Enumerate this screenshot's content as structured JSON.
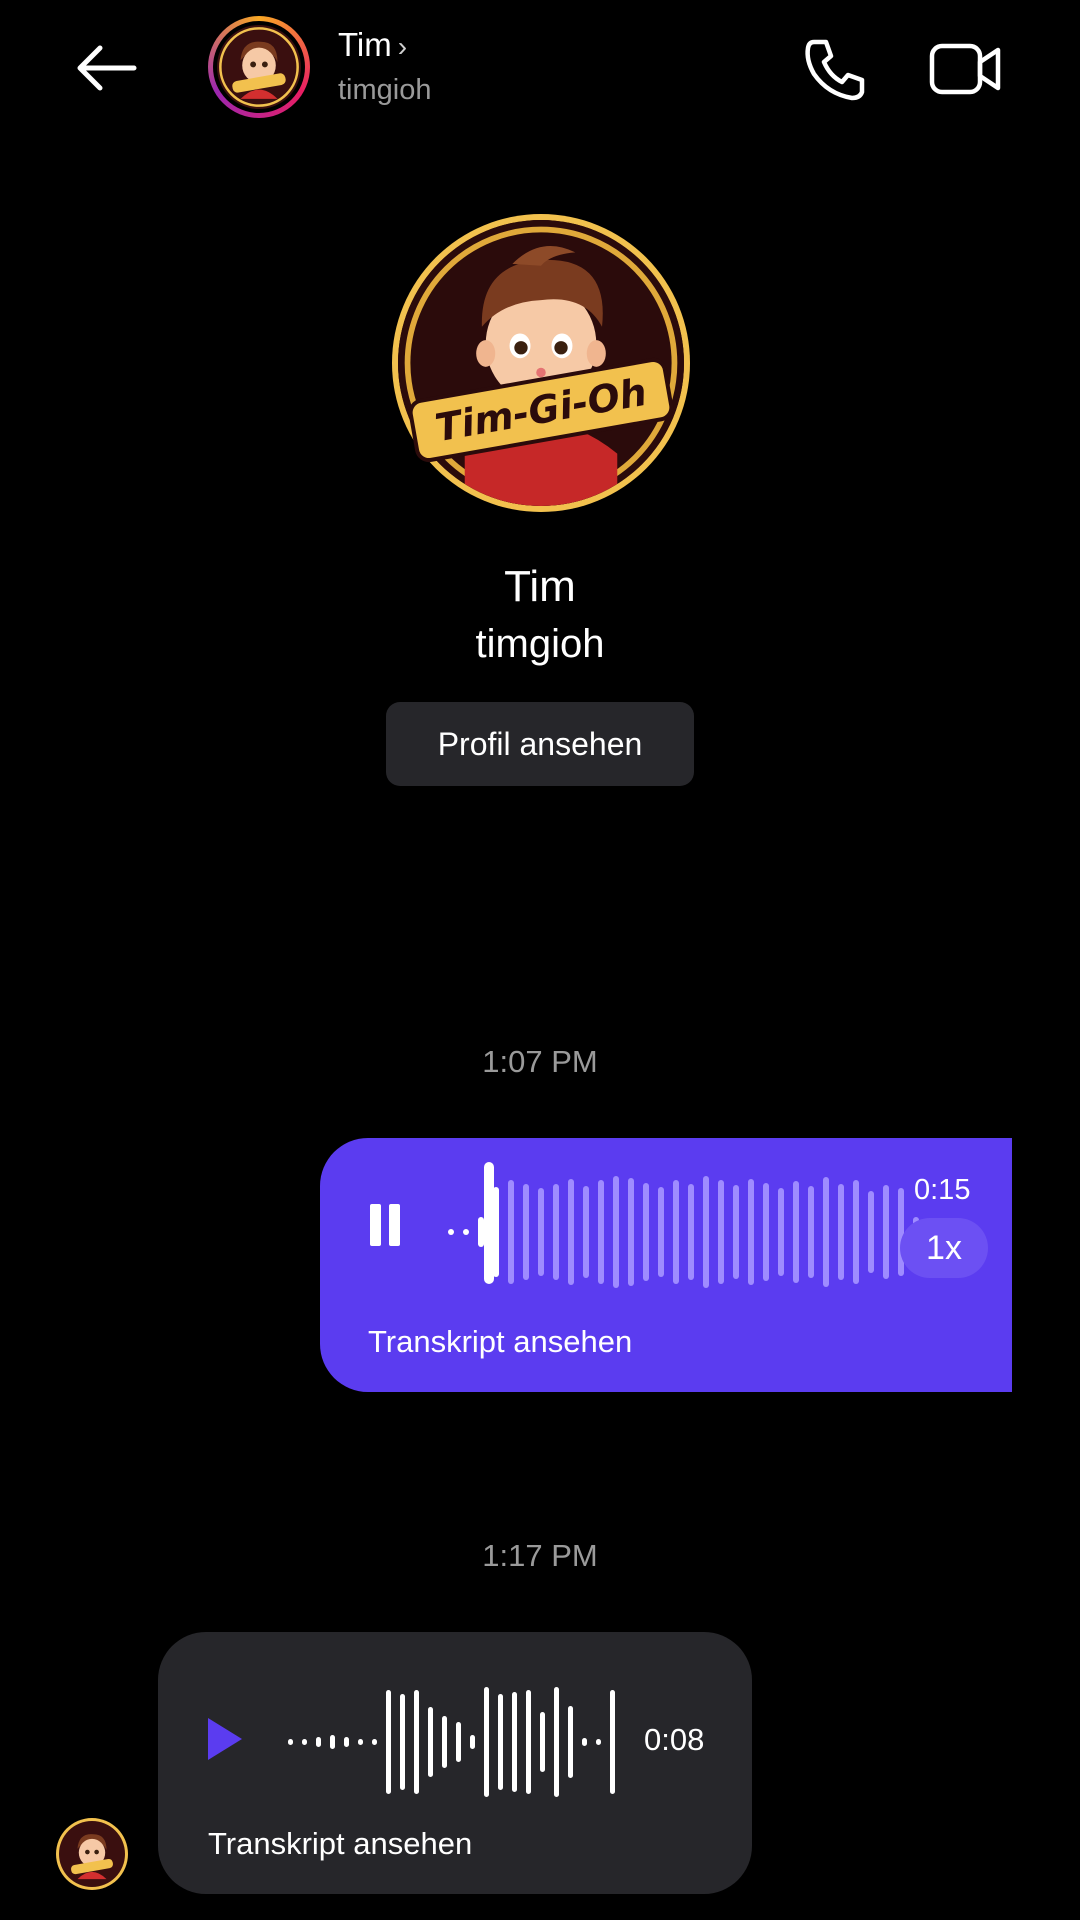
{
  "header": {
    "name": "Tim",
    "chevron": "›",
    "username": "timgioh",
    "icons": [
      "back-arrow-icon",
      "phone-icon",
      "video-camera-icon",
      "chevron-right-icon"
    ]
  },
  "profile": {
    "avatar_text": "Tim-Gi-Oh",
    "name": "Tim",
    "username": "timgioh",
    "view_profile_label": "Profil ansehen"
  },
  "messages": [
    {
      "timestamp": "1:07 PM",
      "direction": "sent",
      "type": "voice",
      "state": "playing",
      "duration": "0:15",
      "speed": "1x",
      "transcript_label": "Transkript ansehen",
      "color": "#5b3cf0"
    },
    {
      "timestamp": "1:17 PM",
      "direction": "received",
      "type": "voice",
      "state": "paused",
      "duration": "0:08",
      "transcript_label": "Transkript ansehen",
      "color": "#26262a"
    }
  ],
  "colors": {
    "background": "#000000",
    "accent": "#5b3cf0",
    "play_icon": "#5b3cf0",
    "muted_text": "#9a9a9a"
  }
}
